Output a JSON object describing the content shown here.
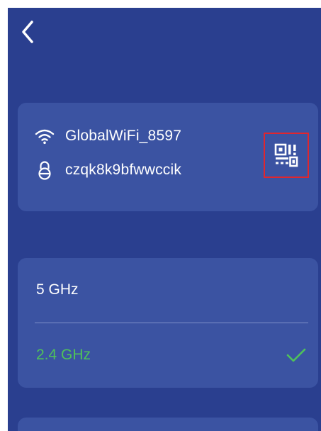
{
  "wifi": {
    "ssid": "GlobalWiFi_8597",
    "password": "czqk8k9bfwwccik"
  },
  "bands": [
    {
      "label": "5 GHz",
      "selected": false
    },
    {
      "label": "2.4 GHz",
      "selected": true
    }
  ],
  "icons": {
    "back": "chevron-left-icon",
    "wifi": "wifi-icon",
    "lock": "lock-icon",
    "qr": "qr-code-icon",
    "check": "checkmark-icon"
  },
  "colors": {
    "background": "#2a3f8f",
    "card": "#3b53a2",
    "selected_text": "#4fc25a",
    "highlight_border": "#e0262e"
  }
}
